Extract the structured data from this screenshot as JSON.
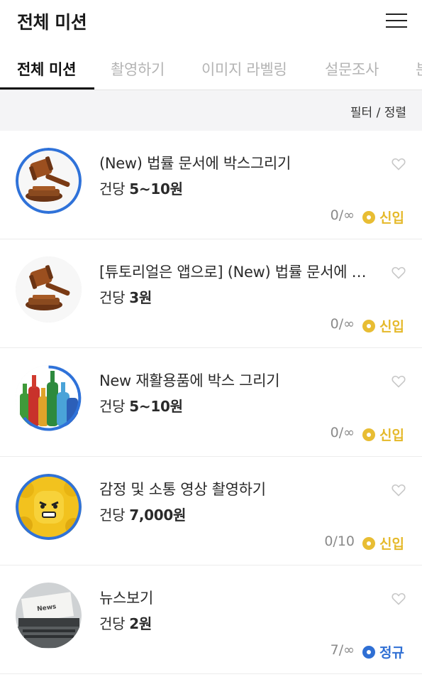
{
  "header": {
    "title": "전체 미션"
  },
  "tabs": [
    {
      "label": "전체 미션"
    },
    {
      "label": "촬영하기"
    },
    {
      "label": "이미지 라벨링"
    },
    {
      "label": "설문조사"
    },
    {
      "label": "분"
    }
  ],
  "filter": {
    "label": "필터 / 정렬"
  },
  "missions": [
    {
      "title": "(New) 법률 문서에 박스그리기",
      "price_prefix": "건당",
      "price": "5~10원",
      "count": "0/∞",
      "badge": "신입",
      "badge_type": "new",
      "thumbnail": "gavel-icon"
    },
    {
      "title": "[튜토리얼은 앱으로] (New) 법률 문서에 …",
      "price_prefix": "건당",
      "price": "3원",
      "count": "0/∞",
      "badge": "신입",
      "badge_type": "new",
      "thumbnail": "gavel-icon"
    },
    {
      "title": "New 재활용품에 박스 그리기",
      "price_prefix": "건당",
      "price": "5~10원",
      "count": "0/∞",
      "badge": "신입",
      "badge_type": "new",
      "thumbnail": "bottles-icon"
    },
    {
      "title": "감정 및 소통 영상 촬영하기",
      "price_prefix": "건당",
      "price": "7,000원",
      "count": "0/10",
      "badge": "신입",
      "badge_type": "new",
      "thumbnail": "toy-face-icon"
    },
    {
      "title": "뉴스보기",
      "price_prefix": "건당",
      "price": "2원",
      "count": "7/∞",
      "badge": "정규",
      "badge_type": "regular",
      "thumbnail": "typewriter-icon"
    }
  ],
  "colors": {
    "new_badge": "#e5b92a",
    "regular_badge": "#2f6fd4",
    "ring": "#2f72d9"
  }
}
